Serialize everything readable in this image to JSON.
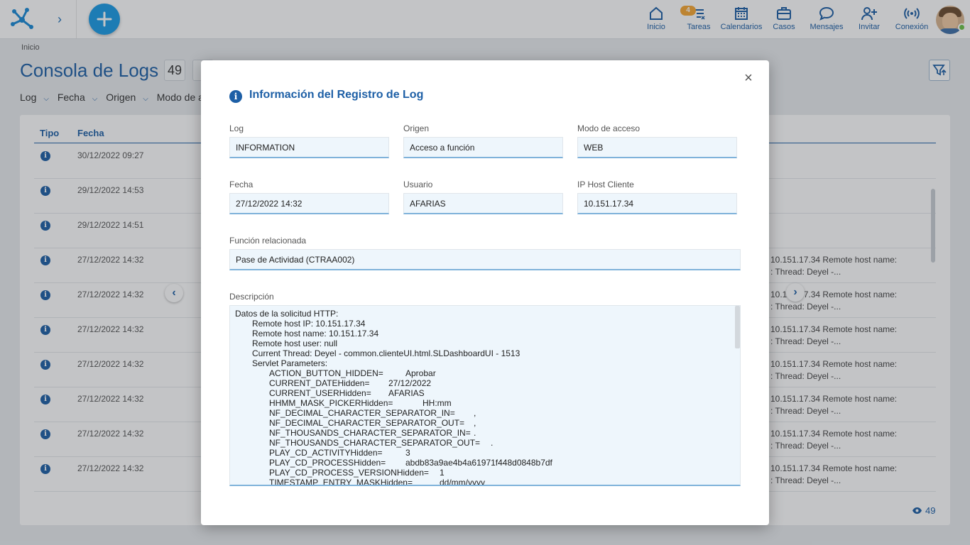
{
  "topbar": {
    "nav": [
      {
        "label": "Inicio",
        "icon": "home-icon"
      },
      {
        "label": "Tareas",
        "icon": "tasks-icon",
        "badge": "4"
      },
      {
        "label": "Calendarios",
        "icon": "calendar-icon"
      },
      {
        "label": "Casos",
        "icon": "briefcase-icon"
      },
      {
        "label": "Mensajes",
        "icon": "chat-icon"
      },
      {
        "label": "Invitar",
        "icon": "invite-user-icon"
      },
      {
        "label": "Conexión",
        "icon": "connection-icon"
      }
    ],
    "accent": "#1a9be6",
    "badge_color": "#f7a733"
  },
  "page": {
    "breadcrumb": "Inicio",
    "title": "Consola de Logs",
    "count": "49",
    "filters": [
      "Log",
      "Fecha",
      "Origen",
      "Modo de acceso"
    ],
    "footer_count": "49"
  },
  "table": {
    "headers": {
      "tipo": "Tipo",
      "fecha": "Fecha"
    },
    "rows": [
      {
        "date": "30/12/2022 09:27",
        "desc1": "",
        "desc2": ""
      },
      {
        "date": "29/12/2022 14:53",
        "desc1": "",
        "desc2": ""
      },
      {
        "date": "29/12/2022 14:51",
        "desc1": "",
        "desc2": ""
      },
      {
        "date": "27/12/2022 14:32",
        "desc1": "10.151.17.34 Remote host name:",
        "desc2": ": Thread: Deyel -..."
      },
      {
        "date": "27/12/2022 14:32",
        "desc1": "10.151.17.34 Remote host name:",
        "desc2": ": Thread: Deyel -..."
      },
      {
        "date": "27/12/2022 14:32",
        "desc1": "10.151.17.34 Remote host name:",
        "desc2": ": Thread: Deyel -..."
      },
      {
        "date": "27/12/2022 14:32",
        "desc1": "10.151.17.34 Remote host name:",
        "desc2": ": Thread: Deyel -..."
      },
      {
        "date": "27/12/2022 14:32",
        "desc1": "10.151.17.34 Remote host name:",
        "desc2": ": Thread: Deyel -..."
      },
      {
        "date": "27/12/2022 14:32",
        "desc1": "10.151.17.34 Remote host name:",
        "desc2": ": Thread: Deyel -..."
      },
      {
        "date": "27/12/2022 14:32",
        "desc1": "10.151.17.34 Remote host name:",
        "desc2": ": Thread: Deyel -..."
      }
    ]
  },
  "modal": {
    "title": "Información del Registro de Log",
    "fields": {
      "log": {
        "label": "Log",
        "value": "INFORMATION"
      },
      "origen": {
        "label": "Origen",
        "value": "Acceso a función"
      },
      "modo": {
        "label": "Modo de acceso",
        "value": "WEB"
      },
      "fecha": {
        "label": "Fecha",
        "value": "27/12/2022 14:32"
      },
      "usuario": {
        "label": "Usuario",
        "value": "AFARIAS"
      },
      "ip": {
        "label": "IP Host Cliente",
        "value": "10.151.17.34"
      },
      "funcion": {
        "label": "Función relacionada",
        "value": "Pase de Actividad (CTRAA002)"
      }
    },
    "description_label": "Descripción",
    "description_lines": [
      {
        "indent": 0,
        "text": "Datos de la solicitud HTTP:",
        "val": ""
      },
      {
        "indent": 1,
        "text": "Remote host IP: 10.151.17.34",
        "val": ""
      },
      {
        "indent": 1,
        "text": "Remote host name: 10.151.17.34",
        "val": ""
      },
      {
        "indent": 1,
        "text": "Remote host user: null",
        "val": ""
      },
      {
        "indent": 1,
        "text": "Current Thread: Deyel - common.clienteUI.html.SLDashboardUI - 1513",
        "val": ""
      },
      {
        "indent": 1,
        "text": "Servlet Parameters:",
        "val": ""
      },
      {
        "indent": 2,
        "text": "ACTION_BUTTON_HIDDEN=",
        "val": "Aprobar",
        "valx": 247
      },
      {
        "indent": 2,
        "text": "CURRENT_DATEHidden=",
        "val": "27/12/2022",
        "valx": 223
      },
      {
        "indent": 2,
        "text": "CURRENT_USERHidden=",
        "val": "AFARIAS",
        "valx": 223
      },
      {
        "indent": 2,
        "text": "HHMM_MASK_PICKERHidden=",
        "val": "HH:mm",
        "valx": 271
      },
      {
        "indent": 2,
        "text": "NF_DECIMAL_CHARACTER_SEPARATOR_IN=",
        "val": ",",
        "valx": 343
      },
      {
        "indent": 2,
        "text": "NF_DECIMAL_CHARACTER_SEPARATOR_OUT=",
        "val": ",",
        "valx": 343
      },
      {
        "indent": 2,
        "text": "NF_THOUSANDS_CHARACTER_SEPARATOR_IN=",
        "val": ".",
        "valx": 343
      },
      {
        "indent": 2,
        "text": "NF_THOUSANDS_CHARACTER_SEPARATOR_OUT=",
        "val": ".",
        "valx": 367
      },
      {
        "indent": 2,
        "text": "PLAY_CD_ACTIVITYHidden=",
        "val": "3",
        "valx": 247
      },
      {
        "indent": 2,
        "text": "PLAY_CD_PROCESSHidden=",
        "val": "abdb83a9ae4b4a61971f448d0848b7df",
        "valx": 247
      },
      {
        "indent": 2,
        "text": "PLAY_CD_PROCESS_VERSIONHidden=",
        "val": "1",
        "valx": 295
      },
      {
        "indent": 2,
        "text": "TIMESTAMP_ENTRY_MASKHidden=",
        "val": "dd/mm/yyyy",
        "valx": 295
      }
    ]
  }
}
